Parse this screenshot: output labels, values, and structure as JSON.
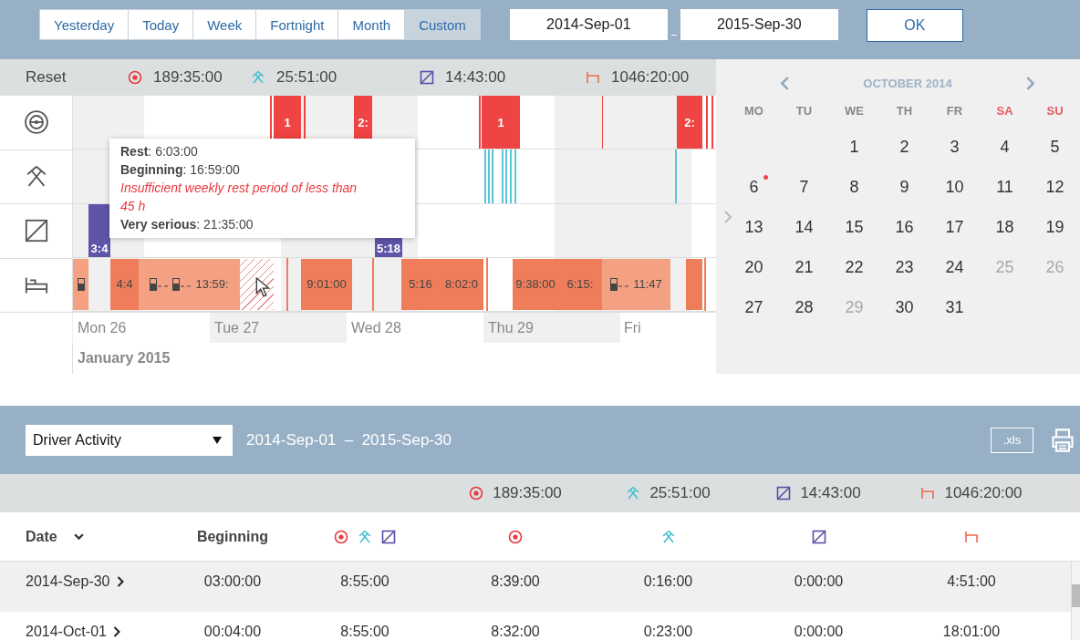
{
  "range_buttons": [
    {
      "label": "Yesterday",
      "selected": false
    },
    {
      "label": "Today",
      "selected": false
    },
    {
      "label": "Week",
      "selected": false
    },
    {
      "label": "Fortnight",
      "selected": false
    },
    {
      "label": "Month",
      "selected": false
    },
    {
      "label": "Custom",
      "selected": true
    }
  ],
  "date_from": "2014-Sep-01",
  "date_to": "2015-Sep-30",
  "ok_button": "OK",
  "summary": {
    "reset": "Reset",
    "totals": [
      {
        "kind": "drive",
        "value": "189:35:00"
      },
      {
        "kind": "work",
        "value": "25:51:00"
      },
      {
        "kind": "available",
        "value": "14:43:00"
      },
      {
        "kind": "rest",
        "value": "1046:20:00"
      }
    ]
  },
  "timeline": {
    "rows": [
      {
        "kind": "drive",
        "blocks": [
          {
            "label": "1"
          },
          {
            "label": "2:"
          },
          {
            "label": "1"
          },
          {
            "label": "2:"
          }
        ]
      },
      {
        "kind": "work",
        "blocks": []
      },
      {
        "kind": "available",
        "blocks": [
          {
            "label": "3:4"
          },
          {
            "label": "5:18"
          }
        ]
      },
      {
        "kind": "rest",
        "blocks": [
          {
            "label": "4:4"
          },
          {
            "label": "13:59:"
          },
          {
            "label": "9:01:00"
          },
          {
            "label": "5:16"
          },
          {
            "label": "8:02:0"
          },
          {
            "label": "9:38:00"
          },
          {
            "label": "6:15:"
          },
          {
            "label": "11:47"
          }
        ]
      }
    ],
    "days": [
      "Mon 26",
      "Tue 27",
      "Wed 28",
      "Thu 29",
      "Fri"
    ],
    "month": "January 2015",
    "tooltip": [
      {
        "kind": "field",
        "text": "**Rest**: 6:03:00"
      },
      {
        "kind": "field",
        "text": "**Beginning**: 16:59:00"
      },
      {
        "kind": "warning",
        "text": "Insufficient weekly rest period of less than 45 h"
      },
      {
        "kind": "field",
        "text": "**Very serious**: 21:35:00"
      }
    ]
  },
  "calendar": {
    "month": "OCTOBER 2014",
    "weekdays": [
      {
        "label": "MO",
        "weekend": false
      },
      {
        "label": "TU",
        "weekend": false
      },
      {
        "label": "WE",
        "weekend": false
      },
      {
        "label": "TH",
        "weekend": false
      },
      {
        "label": "FR",
        "weekend": false
      },
      {
        "label": "SA",
        "weekend": true
      },
      {
        "label": "SU",
        "weekend": true
      }
    ],
    "weeks": [
      {
        "days": [
          {
            "day": "1",
            "disabled": false,
            "marked": false
          },
          {
            "day": "2",
            "disabled": false,
            "marked": false
          },
          {
            "day": "3",
            "disabled": false,
            "marked": false
          },
          {
            "day": "4",
            "disabled": false,
            "marked": false
          },
          {
            "day": "5",
            "disabled": false,
            "marked": false
          }
        ]
      },
      {
        "days": [
          {
            "day": "6",
            "disabled": false,
            "marked": true
          },
          {
            "day": "7",
            "disabled": false,
            "marked": false
          },
          {
            "day": "8",
            "disabled": false,
            "marked": false
          },
          {
            "day": "9",
            "disabled": false,
            "marked": false
          },
          {
            "day": "10",
            "disabled": false,
            "marked": false
          },
          {
            "day": "11",
            "disabled": false,
            "marked": false
          },
          {
            "day": "12",
            "disabled": false,
            "marked": false
          }
        ]
      },
      {
        "days": [
          {
            "day": "13",
            "disabled": false,
            "marked": false
          },
          {
            "day": "14",
            "disabled": false,
            "marked": false
          },
          {
            "day": "15",
            "disabled": false,
            "marked": false
          },
          {
            "day": "16",
            "disabled": false,
            "marked": false
          },
          {
            "day": "17",
            "disabled": false,
            "marked": false
          },
          {
            "day": "18",
            "disabled": false,
            "marked": false
          },
          {
            "day": "19",
            "disabled": false,
            "marked": false
          }
        ]
      },
      {
        "days": [
          {
            "day": "20",
            "disabled": false,
            "marked": false
          },
          {
            "day": "21",
            "disabled": false,
            "marked": false
          },
          {
            "day": "22",
            "disabled": false,
            "marked": false
          },
          {
            "day": "23",
            "disabled": false,
            "marked": false
          },
          {
            "day": "24",
            "disabled": false,
            "marked": false
          },
          {
            "day": "25",
            "disabled": true,
            "marked": false
          },
          {
            "day": "26",
            "disabled": true,
            "marked": false
          }
        ]
      },
      {
        "days": [
          {
            "day": "27",
            "disabled": false,
            "marked": false
          },
          {
            "day": "28",
            "disabled": false,
            "marked": false
          },
          {
            "day": "29",
            "disabled": true,
            "marked": false
          },
          {
            "day": "30",
            "disabled": false,
            "marked": false
          },
          {
            "day": "31",
            "disabled": false,
            "marked": false
          }
        ]
      }
    ]
  },
  "report": {
    "dropdown": "Driver Activity",
    "range": "2014-Sep-01  –  2015-Sep-30",
    "export_button": ".xls",
    "totals": [
      {
        "kind": "drive",
        "value": "189:35:00"
      },
      {
        "kind": "work",
        "value": "25:51:00"
      },
      {
        "kind": "available",
        "value": "14:43:00"
      },
      {
        "kind": "rest",
        "value": "1046:20:00"
      }
    ],
    "columns": [
      {
        "kind": "text",
        "label": "Date",
        "sorted": true
      },
      {
        "kind": "text",
        "label": "Beginning",
        "sorted": false
      },
      {
        "kind": "working-time"
      },
      {
        "kind": "drive"
      },
      {
        "kind": "work"
      },
      {
        "kind": "available"
      },
      {
        "kind": "rest"
      }
    ],
    "rows": [
      {
        "cells": [
          "2014-Sep-30",
          "03:00:00",
          "8:55:00",
          "8:39:00",
          "0:16:00",
          "0:00:00",
          "4:51:00"
        ]
      },
      {
        "cells": [
          "2014-Oct-01",
          "00:04:00",
          "8:55:00",
          "8:32:00",
          "0:23:00",
          "0:00:00",
          "18:01:00"
        ]
      }
    ]
  }
}
